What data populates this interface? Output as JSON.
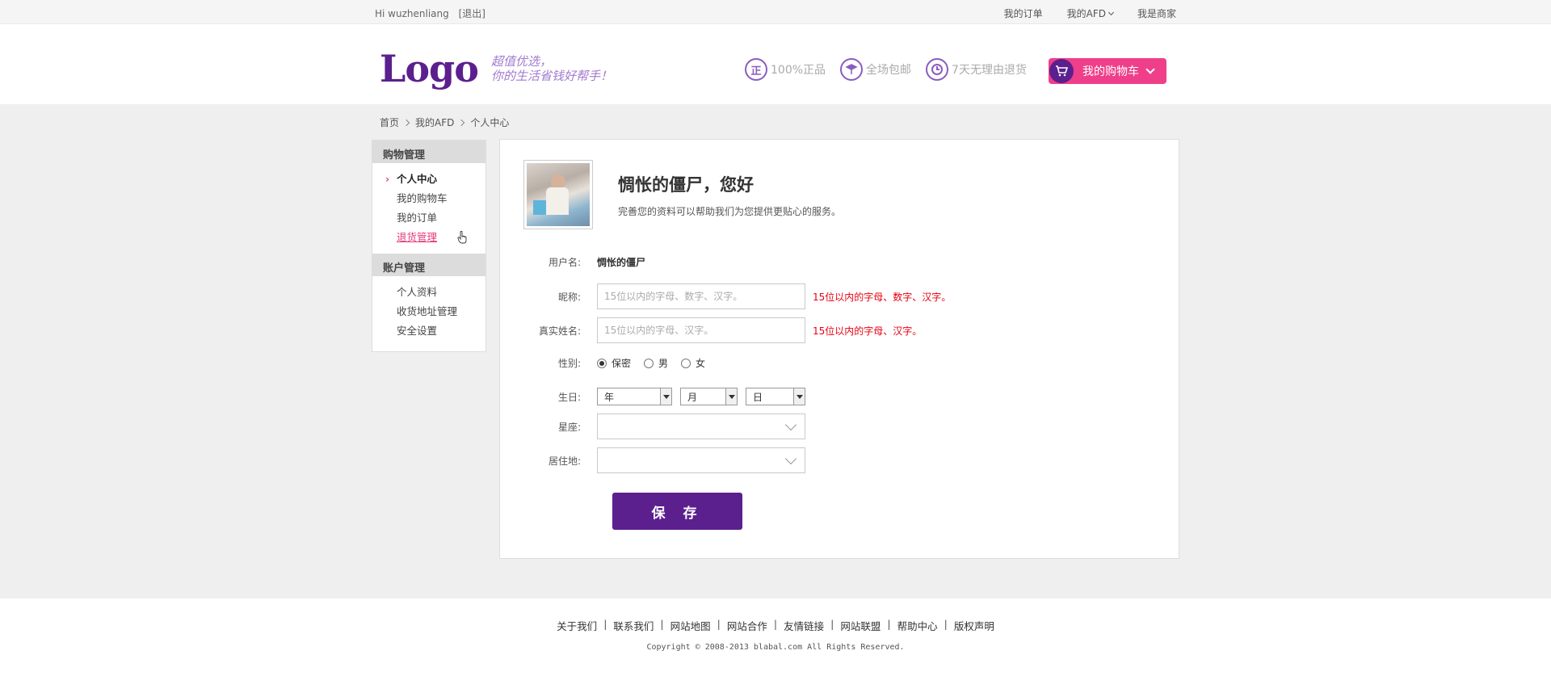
{
  "topbar": {
    "greeting": "Hi wuzhenliang",
    "logout": "[退出]",
    "links": [
      "我的订单",
      "我的AFD",
      "我是商家"
    ]
  },
  "header": {
    "logo": "Logo",
    "slogan_line1": "超值优选，",
    "slogan_line2": "你的生活省钱好帮手！",
    "features": [
      {
        "icon": "genuine-icon",
        "glyph": "正",
        "label": "100%正品"
      },
      {
        "icon": "shipping-icon",
        "label": "全场包邮"
      },
      {
        "icon": "clock-icon",
        "label": "7天无理由退货"
      }
    ],
    "cart_label": "我的购物车"
  },
  "breadcrumb": [
    "首页",
    "我的AFD",
    "个人中心"
  ],
  "sidebar": {
    "sections": [
      {
        "title": "购物管理",
        "items": [
          "个人中心",
          "我的购物车",
          "我的订单",
          "退货管理"
        ]
      },
      {
        "title": "账户管理",
        "items": [
          "个人资料",
          "收货地址管理",
          "安全设置"
        ]
      }
    ],
    "active": "个人中心",
    "hovered": "退货管理"
  },
  "profile": {
    "greeting": "惆怅的僵尸，您好",
    "subtext": "完善您的资料可以帮助我们为您提供更贴心的服务。"
  },
  "form": {
    "username_label": "用户名:",
    "username_value": "惆怅的僵尸",
    "nickname_label": "昵称:",
    "nickname_placeholder": "15位以内的字母、数字、汉字。",
    "nickname_hint": "15位以内的字母、数字、汉字。",
    "realname_label": "真实姓名:",
    "realname_placeholder": "15位以内的字母、汉字。",
    "realname_hint": "15位以内的字母、汉字。",
    "gender_label": "性别:",
    "gender_options": [
      "保密",
      "男",
      "女"
    ],
    "gender_selected": "保密",
    "birthday_label": "生日:",
    "birthday_year": "年",
    "birthday_month": "月",
    "birthday_day": "日",
    "zodiac_label": "星座:",
    "residence_label": "居住地:",
    "save_label": "保 存"
  },
  "footer": {
    "links": [
      "关于我们",
      "联系我们",
      "网站地图",
      "网站合作",
      "友情链接",
      "网站联盟",
      "帮助中心",
      "版权声明"
    ],
    "copyright": "Copyright © 2008-2013 blabal.com All Rights Reserved."
  },
  "colors": {
    "brand_purple": "#5b1f8e",
    "accent_pink": "#ef3f8a",
    "error_red": "#e60012"
  }
}
